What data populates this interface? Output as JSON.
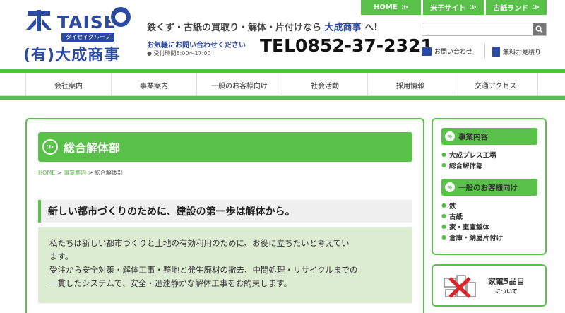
{
  "topnav": {
    "home": "HOME",
    "yonago": "米子サイト",
    "kobutsu": "古紙ランド",
    "chevron": "≫"
  },
  "header": {
    "logo_brand": "TAISEI",
    "logo_group": "タイセイグループ",
    "logo_company": "(有)大成商事",
    "tagline_prefix": "鉄くず・古紙の買取り・解体・片付けなら ",
    "tagline_company": "大成商事",
    "tagline_suffix": " へ!",
    "contact_lead": "お気軽にお問い合わせください",
    "hours": "● 受付時間8:00～17:00",
    "tel": "TEL0852-37-2321",
    "search_placeholder": "",
    "inquiry": "お問い合わせ",
    "estimate": "無料お見積り"
  },
  "gnav": [
    "会社案内",
    "事業案内",
    "一般のお客様向け",
    "社会活動",
    "採用情報",
    "交通アクセス"
  ],
  "main": {
    "page_title": "総合解体部",
    "breadcrumb": {
      "home": "HOME",
      "sep": " > ",
      "parent": "事業案内",
      "current": "総合解体部"
    },
    "section_title": "新しい都市づくりのために、建設の第一歩は解体から。",
    "lead_line1": "私たちは新しい都市づくりと土地の有効利用のために、お役に立ちたいと考えてい",
    "lead_line2": "ます。",
    "lead_line3": "受注から安全対策・解体工事・整地と発生廃材の撤去、中間処理・リサイクルまでの",
    "lead_line4": "一貫したシステムで、安全・迅速静かな解体工事をお約束します。"
  },
  "sidebar": {
    "heading1": "事業内容",
    "list1": [
      "大成プレス工場",
      "総合解体部"
    ],
    "heading2": "一般のお客様向け",
    "list2": [
      "鉄",
      "古紙",
      "家・車庫解体",
      "倉庫・納屋片付け"
    ]
  },
  "banner": {
    "title": "家電5品目",
    "sub": "について"
  },
  "colors": {
    "accent_green": "#59c14a",
    "brand_blue": "#2b4aa0",
    "lead_bg": "#dcecd2"
  }
}
